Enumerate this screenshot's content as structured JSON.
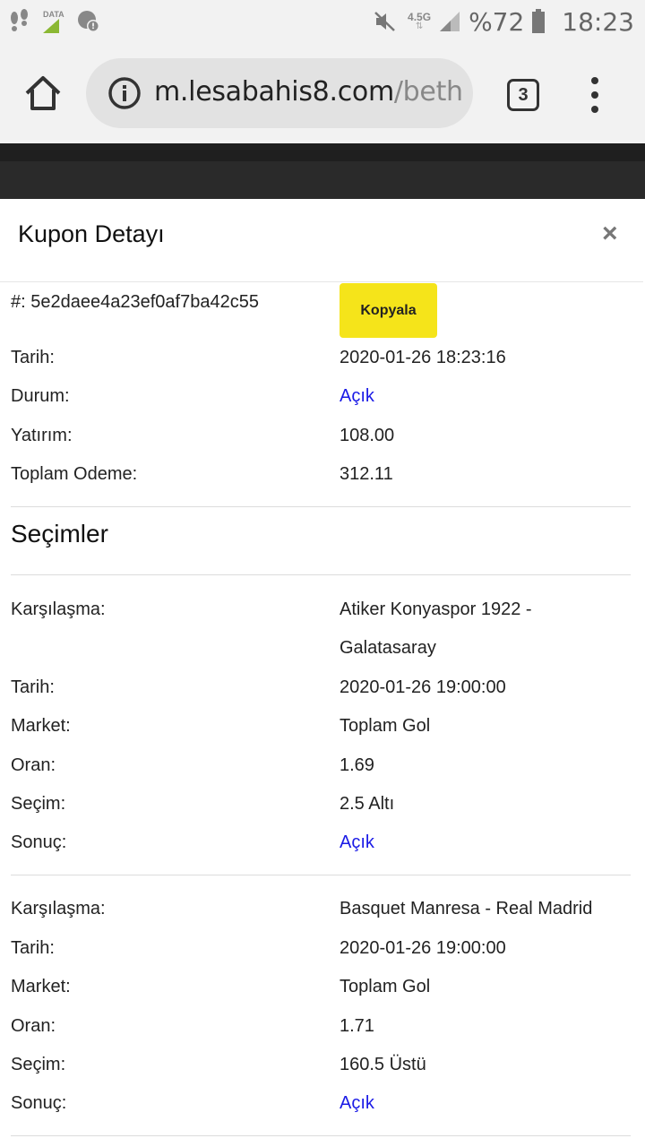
{
  "status_bar": {
    "network_label": "DATA",
    "signal_type": "4.5G",
    "battery": "%72",
    "time": "18:23",
    "icons": [
      "footsteps-icon",
      "data-icon",
      "notification-alert-icon",
      "mute-icon",
      "signal-icon",
      "battery-icon"
    ]
  },
  "browser": {
    "url_domain": "m.lesabahis8.com",
    "url_path": "/beth",
    "tab_count": "3"
  },
  "modal": {
    "title": "Kupon Detayı",
    "close_label": "×",
    "coupon": {
      "id_label": "#:",
      "id_value": "5e2daee4a23ef0af7ba42c55",
      "copy_label": "Kopyala",
      "date_label": "Tarih:",
      "date_value": "2020-01-26 18:23:16",
      "status_label": "Durum:",
      "status_value": "Açık",
      "stake_label": "Yatırım:",
      "stake_value": "108.00",
      "total_label": "Toplam Odeme:",
      "total_value": "312.11"
    },
    "selections_title": "Seçimler",
    "selections": [
      {
        "match_label": "Karşılaşma:",
        "match_line1": "Atiker Konyaspor 1922 -",
        "match_line2": "Galatasaray",
        "date_label": "Tarih:",
        "date_value": "2020-01-26 19:00:00",
        "market_label": "Market:",
        "market_value": "Toplam Gol",
        "odds_label": "Oran:",
        "odds_value": "1.69",
        "pick_label": "Seçim:",
        "pick_value": "2.5 Altı",
        "result_label": "Sonuç:",
        "result_value": "Açık"
      },
      {
        "match_label": "Karşılaşma:",
        "match_line1": "Basquet Manresa - Real Madrid",
        "date_label": "Tarih:",
        "date_value": "2020-01-26 19:00:00",
        "market_label": "Market:",
        "market_value": "Toplam Gol",
        "odds_label": "Oran:",
        "odds_value": "1.71",
        "pick_label": "Seçim:",
        "pick_value": "160.5 Üstü",
        "result_label": "Sonuç:",
        "result_value": "Açık"
      }
    ]
  },
  "colors": {
    "copy_button": "#f5e41a",
    "status_open": "#1a1ae6",
    "page_dark": "#1f1f1f"
  }
}
